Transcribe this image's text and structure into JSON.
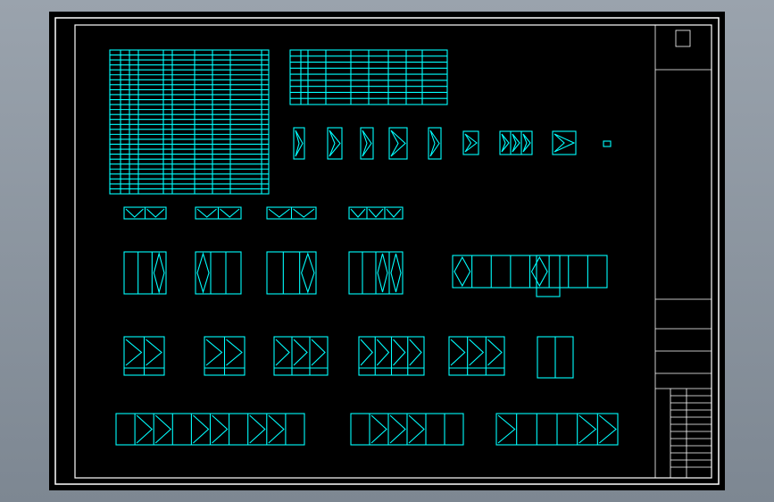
{
  "colors": {
    "background": "#000000",
    "frame": "#ffffff",
    "geometry": "#00ffff",
    "outer_chrome": "#8c95a0"
  },
  "title_block": {
    "header_text_1": "",
    "header_text_2": "",
    "project_name": "",
    "drawing_title": "",
    "drawing_number": "",
    "scale": ""
  },
  "sheet": {
    "schedule_tables": 2,
    "window_elevations": 9,
    "sash_strips": 4,
    "door_window_groups": 5,
    "casement_groups": 6,
    "long_window_groups": 3
  }
}
